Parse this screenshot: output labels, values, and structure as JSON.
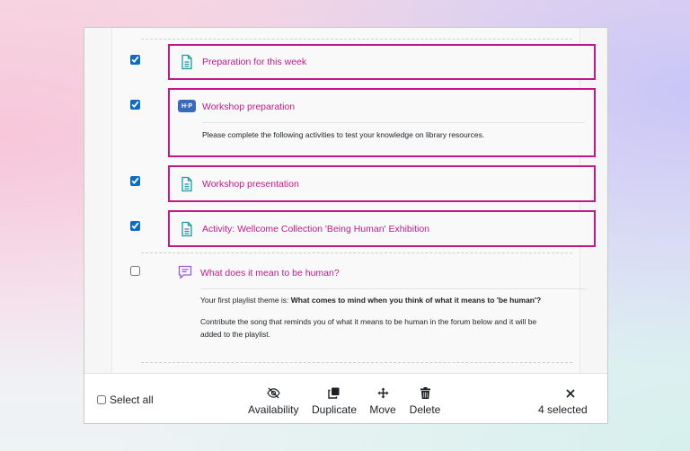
{
  "items": [
    {
      "checked": true,
      "icon": "page-icon",
      "title": "Preparation for this week"
    },
    {
      "checked": true,
      "icon": "h5p-icon",
      "icon_text": "H·P",
      "title": "Workshop preparation",
      "description": "Please complete the following activities to test your knowledge on library resources."
    },
    {
      "checked": true,
      "icon": "page-icon",
      "title": "Workshop presentation"
    },
    {
      "checked": true,
      "icon": "page-icon",
      "title": "Activity: Wellcome Collection 'Being Human' Exhibition"
    },
    {
      "checked": false,
      "icon": "forum-icon",
      "title": "What does it mean to be human?",
      "description_prefix": "Your first playlist theme is: ",
      "description_bold": "What comes to mind when you think of what it means to 'be human'?",
      "description2": "Contribute the song that reminds you of what it means to be human in the forum below and it will be added to the playlist."
    }
  ],
  "toolbar": {
    "select_all": "Select all",
    "availability": "Availability",
    "duplicate": "Duplicate",
    "move": "Move",
    "delete": "Delete",
    "selected_count": "4 selected"
  },
  "colors": {
    "accent": "#c2198a",
    "page_icon": "#1b9aa6",
    "h5p": "#3b6bb8",
    "forum_icon": "#9b59d9"
  }
}
